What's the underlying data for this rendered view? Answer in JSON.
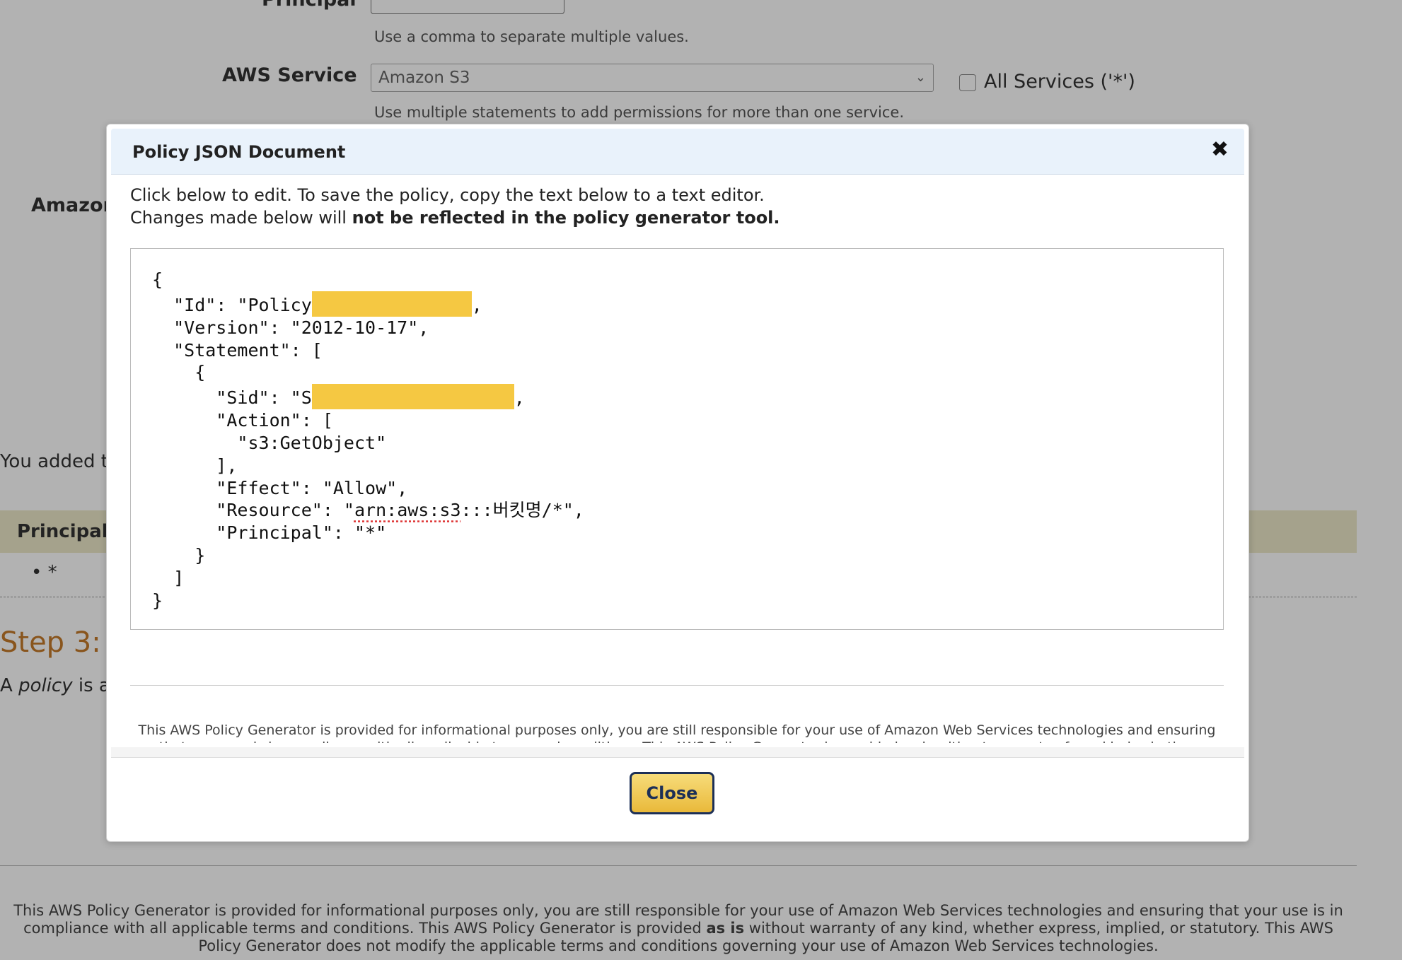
{
  "background": {
    "principal_label": "Principal",
    "principal_hint": "Use a comma to separate multiple values.",
    "service_label": "AWS Service",
    "service_value": "Amazon S3",
    "all_services_label": "All Services ('*')",
    "service_hint": "Use multiple statements to add permissions for more than one service.",
    "amazon_label": "Amazon",
    "added_text": "You added t",
    "table_header_principal": "Principal",
    "principal_bullet": "• *",
    "step_title": "Step 3:",
    "policy_prefix": "A ",
    "policy_word": "policy",
    "policy_suffix": " is a",
    "disclaimer_part1": "This AWS Policy Generator is provided for informational purposes only, you are still responsible for your use of Amazon Web Services technologies and ensuring that your use is in compliance with all applicable terms and conditions. This AWS Policy Generator is provided ",
    "disclaimer_bold": "as is",
    "disclaimer_part2": " without warranty of any kind, whether express, implied, or statutory. This AWS Policy Generator does not modify the applicable terms and conditions governing your use of Amazon Web Services technologies."
  },
  "modal": {
    "title": "Policy JSON Document",
    "close_icon": "close-icon",
    "intro_line1": "Click below to edit. To save the policy, copy the text below to a text editor.",
    "intro_line2_prefix": "Changes made below will ",
    "intro_line2_bold": "not be reflected in the policy generator tool.",
    "json": {
      "open_brace": "{",
      "id_line": "  \"Id\": \"Policy",
      "id_tail": ",",
      "version_line": "  \"Version\": \"2012-10-17\",",
      "statement_line": "  \"Statement\": [",
      "stmt_open": "    {",
      "sid_line": "      \"Sid\": \"S",
      "sid_tail": ",",
      "action_line": "      \"Action\": [",
      "action_value": "        \"s3:GetObject\"",
      "action_close": "      ],",
      "effect_line": "      \"Effect\": \"Allow\",",
      "resource_prefix": "      \"Resource\": \"",
      "resource_arn": "arn:aws:s3",
      "resource_suffix": ":::버킷명/*\",",
      "principal_line": "      \"Principal\": \"*\"",
      "stmt_close": "    }",
      "array_close": "  ]",
      "close_brace": "}"
    },
    "disclaimer": "This AWS Policy Generator is provided for informational purposes only, you are still responsible for your use of Amazon Web Services technologies and ensuring that your use is in compliance with all applicable terms and conditions. This AWS Policy Generator is provided as is without warranty of any kind, whether express,",
    "close_button_label": "Close"
  },
  "colors": {
    "redaction": "#f5c842",
    "button_border": "#1c2f57",
    "header_bg": "#e9f2fb"
  }
}
